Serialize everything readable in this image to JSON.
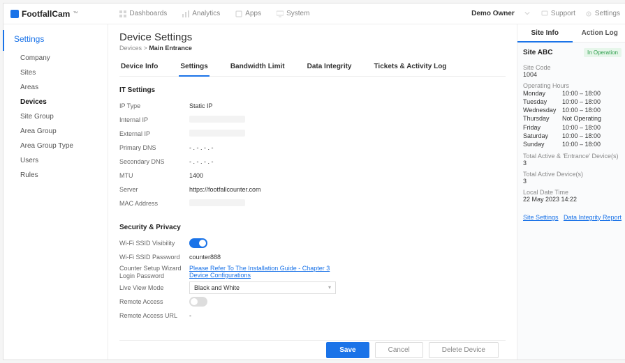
{
  "brand": {
    "name": "FootfallCam",
    "tm": "™"
  },
  "top_tabs": {
    "dashboards": "Dashboards",
    "analytics": "Analytics",
    "apps": "Apps",
    "system": "System"
  },
  "top_right": {
    "owner": "Demo Owner",
    "support": "Support",
    "settings": "Settings"
  },
  "leftnav": {
    "title": "Settings",
    "items": [
      {
        "label": "Company",
        "active": false
      },
      {
        "label": "Sites",
        "active": false
      },
      {
        "label": "Areas",
        "active": false
      },
      {
        "label": "Devices",
        "active": true
      },
      {
        "label": "Site Group",
        "active": false
      },
      {
        "label": "Area Group",
        "active": false
      },
      {
        "label": "Area Group Type",
        "active": false
      },
      {
        "label": "Users",
        "active": false
      },
      {
        "label": "Rules",
        "active": false
      }
    ]
  },
  "page": {
    "title": "Device Settings",
    "crumb_parent": "Devices",
    "crumb_sep": ">",
    "crumb_current": "Main Entrance"
  },
  "device_tabs": {
    "info": "Device Info",
    "settings": "Settings",
    "bandwidth": "Bandwidth Limit",
    "integrity": "Data Integrity",
    "tickets": "Tickets & Activity Log"
  },
  "it_settings": {
    "section_title": "IT Settings",
    "ip_type": {
      "label": "IP Type",
      "value": "Static IP"
    },
    "internal_ip": {
      "label": "Internal IP",
      "value": ""
    },
    "external_ip": {
      "label": "External IP",
      "value": ""
    },
    "primary_dns": {
      "label": "Primary DNS",
      "value": "- . - . - . -"
    },
    "secondary_dns": {
      "label": "Secondary DNS",
      "value": "- . - . - . -"
    },
    "mtu": {
      "label": "MTU",
      "value": "1400"
    },
    "server": {
      "label": "Server",
      "value": "https://footfallcounter.com"
    },
    "mac": {
      "label": "MAC Address",
      "value": ""
    }
  },
  "security": {
    "section_title": "Security & Privacy",
    "ssid_visibility": {
      "label": "Wi-Fi SSID Visibility"
    },
    "ssid_password": {
      "label": "Wi-Fi SSID Password",
      "value": "counter888"
    },
    "wizard_pw": {
      "label": "Counter Setup Wizard Login Password",
      "link": "Please Refer To The Installation Guide - Chapter 3 Device Configurations"
    },
    "live_view": {
      "label": "Live View Mode",
      "value": "Black and White"
    },
    "remote_access": {
      "label": "Remote Access"
    },
    "remote_url": {
      "label": "Remote Access URL",
      "value": "-"
    }
  },
  "rightpanel": {
    "tab_info": "Site Info",
    "tab_log": "Action Log",
    "site_name": "Site ABC",
    "badge": "In Operation",
    "code_label": "Site Code",
    "code_value": "1004",
    "hours_label": "Operating Hours",
    "hours": [
      {
        "day": "Monday",
        "range": "10:00 – 18:00"
      },
      {
        "day": "Tuesday",
        "range": "10:00 – 18:00"
      },
      {
        "day": "Wednesday",
        "range": "10:00 – 18:00"
      },
      {
        "day": "Thursday",
        "range": "Not Operating"
      },
      {
        "day": "Friday",
        "range": "10:00 – 18:00"
      },
      {
        "day": "Saturday",
        "range": "10:00 – 18:00"
      },
      {
        "day": "Sunday",
        "range": "10:00 – 18:00"
      }
    ],
    "total_entrance_label": "Total Active  & 'Entrance' Device(s)",
    "total_entrance_value": "3",
    "total_active_label": "Total Active Device(s)",
    "total_active_value": "3",
    "local_dt_label": "Local Date Time",
    "local_dt_value": "22 May 2023  14:22",
    "link_settings": "Site Settings",
    "link_report": "Data Integrity Report"
  },
  "footer": {
    "save": "Save",
    "cancel": "Cancel",
    "delete": "Delete Device"
  }
}
